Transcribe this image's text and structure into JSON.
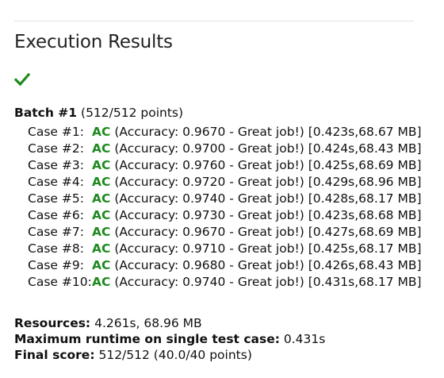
{
  "page": {
    "title": "Execution Results",
    "status_icon": "check-icon",
    "status_color": "#1e8a1e"
  },
  "batch": {
    "label": "Batch #1",
    "points": "(512/512 points)",
    "cases": [
      {
        "label": "Case #1:",
        "verdict": "AC",
        "detail": "(Accuracy: 0.9670 - Great job!)",
        "resources": "[0.423s,68.67 MB]"
      },
      {
        "label": "Case #2:",
        "verdict": "AC",
        "detail": "(Accuracy: 0.9700 - Great job!)",
        "resources": "[0.424s,68.43 MB]"
      },
      {
        "label": "Case #3:",
        "verdict": "AC",
        "detail": "(Accuracy: 0.9760 - Great job!)",
        "resources": "[0.425s,68.69 MB]"
      },
      {
        "label": "Case #4:",
        "verdict": "AC",
        "detail": "(Accuracy: 0.9720 - Great job!)",
        "resources": "[0.429s,68.96 MB]"
      },
      {
        "label": "Case #5:",
        "verdict": "AC",
        "detail": "(Accuracy: 0.9740 - Great job!)",
        "resources": "[0.428s,68.17 MB]"
      },
      {
        "label": "Case #6:",
        "verdict": "AC",
        "detail": "(Accuracy: 0.9730 - Great job!)",
        "resources": "[0.423s,68.68 MB]"
      },
      {
        "label": "Case #7:",
        "verdict": "AC",
        "detail": "(Accuracy: 0.9670 - Great job!)",
        "resources": "[0.427s,68.69 MB]"
      },
      {
        "label": "Case #8:",
        "verdict": "AC",
        "detail": "(Accuracy: 0.9710 - Great job!)",
        "resources": "[0.425s,68.17 MB]"
      },
      {
        "label": "Case #9:",
        "verdict": "AC",
        "detail": "(Accuracy: 0.9680 - Great job!)",
        "resources": "[0.426s,68.43 MB]"
      },
      {
        "label": "Case #10:",
        "verdict": "AC",
        "detail": "(Accuracy: 0.9740 - Great job!)",
        "resources": "[0.431s,68.17 MB]"
      }
    ]
  },
  "summary": {
    "resources_label": "Resources:",
    "resources_value": "4.261s, 68.96 MB",
    "max_runtime_label": "Maximum runtime on single test case:",
    "max_runtime_value": "0.431s",
    "final_score_label": "Final score:",
    "final_score_value": "512/512 (40.0/40 points)"
  }
}
